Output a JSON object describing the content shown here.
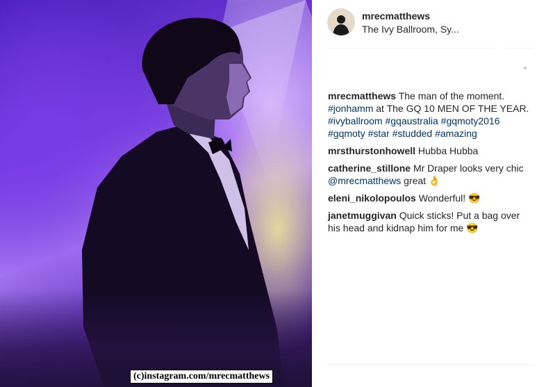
{
  "post": {
    "watermark": "(c)instagram.com/mrecmatthews"
  },
  "header": {
    "username": "mrecmatthews",
    "location": "The Ivy Ballroom, Sy..."
  },
  "caption": {
    "user": "mrecmatthews",
    "text1": "The man of the moment.",
    "tag1": "#jonhamm",
    "text2": "at The GQ 10 MEN OF THE YEAR.",
    "tags": [
      "#ivyballroom",
      "#gqaustralia",
      "#gqmoty2016",
      "#gqmoty",
      "#star",
      "#studded",
      "#amazing"
    ]
  },
  "comments": [
    {
      "user": "mrsthurstonhowell",
      "text": "Hubba Hubba"
    },
    {
      "user": "catherine_stillone",
      "text_before": "Mr Draper looks very chic",
      "mention": "@mrecmatthews",
      "text_after": "great 👌"
    },
    {
      "user": "eleni_nikolopoulos",
      "text": "Wonderful! 😎"
    },
    {
      "user": "janetmuggivan",
      "text": "Quick sticks! Put a bag over his head and kidnap him for me 😎"
    }
  ]
}
